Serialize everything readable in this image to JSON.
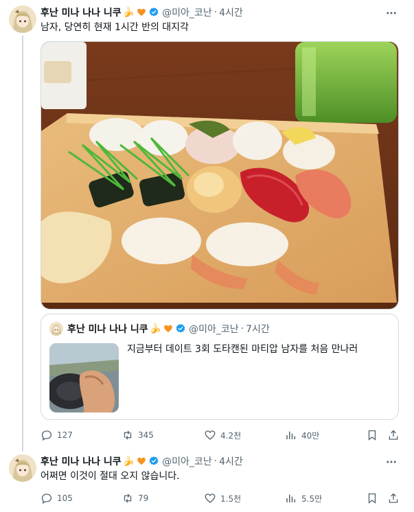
{
  "tweets": [
    {
      "display_name": "후난 미나 나나 니쿠",
      "emoji": "🍌",
      "handle": "@미아_코난",
      "separator": "·",
      "time": "4시간",
      "text": "남자, 당연히 현재 1시간 반의 대지각",
      "quote": {
        "display_name": "후난 미나 나나 니쿠",
        "emoji": "🍌",
        "handle": "@미아_코난",
        "separator": "·",
        "time": "7시간",
        "text": "지금부터 데이트 3회 도타캔된 마티압 남자를 처음 만나러"
      },
      "stats": {
        "replies": "127",
        "retweets": "345",
        "likes": "4.2천",
        "views": "40만"
      }
    },
    {
      "display_name": "후난 미나 나나 니쿠",
      "emoji": "🍌",
      "handle": "@미아_코난",
      "separator": "·",
      "time": "4시간",
      "text": "어쩌면 이것이 절대 오지 않습니다.",
      "stats": {
        "replies": "105",
        "retweets": "79",
        "likes": "1.5천",
        "views": "5.5만"
      }
    }
  ],
  "icons": {
    "verified": "verified-badge-icon",
    "heart": "orange-heart-icon",
    "more": "more-dots-icon",
    "reply": "reply-icon",
    "retweet": "retweet-icon",
    "like": "like-icon",
    "views": "views-icon",
    "bookmark": "bookmark-icon",
    "share": "share-icon"
  },
  "colors": {
    "verified": "#1d9bf0",
    "secondary_text": "#536471",
    "border": "#cfd9de",
    "heart": "#f7931e"
  }
}
